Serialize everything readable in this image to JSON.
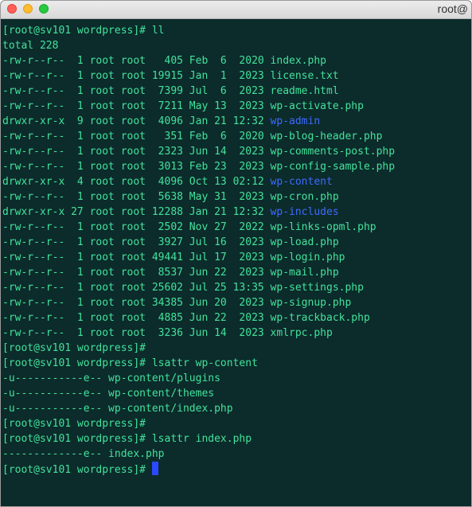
{
  "window": {
    "title": "root@"
  },
  "terminal": {
    "lines": [
      {
        "text": "[root@sv101 wordpress]# ll",
        "kind": "prompt"
      },
      {
        "text": "total 228",
        "kind": "text"
      },
      {
        "prefix": "-rw-r--r--  1 root root   405 Feb  6  2020 ",
        "name": "index.php",
        "kind": "file"
      },
      {
        "prefix": "-rw-r--r--  1 root root 19915 Jan  1  2023 ",
        "name": "license.txt",
        "kind": "file"
      },
      {
        "prefix": "-rw-r--r--  1 root root  7399 Jul  6  2023 ",
        "name": "readme.html",
        "kind": "file"
      },
      {
        "prefix": "-rw-r--r--  1 root root  7211 May 13  2023 ",
        "name": "wp-activate.php",
        "kind": "file"
      },
      {
        "prefix": "drwxr-xr-x  9 root root  4096 Jan 21 12:32 ",
        "name": "wp-admin",
        "kind": "dir"
      },
      {
        "prefix": "-rw-r--r--  1 root root   351 Feb  6  2020 ",
        "name": "wp-blog-header.php",
        "kind": "file"
      },
      {
        "prefix": "-rw-r--r--  1 root root  2323 Jun 14  2023 ",
        "name": "wp-comments-post.php",
        "kind": "file"
      },
      {
        "prefix": "-rw-r--r--  1 root root  3013 Feb 23  2023 ",
        "name": "wp-config-sample.php",
        "kind": "file"
      },
      {
        "prefix": "drwxr-xr-x  4 root root  4096 Oct 13 02:12 ",
        "name": "wp-content",
        "kind": "dir"
      },
      {
        "prefix": "-rw-r--r--  1 root root  5638 May 31  2023 ",
        "name": "wp-cron.php",
        "kind": "file"
      },
      {
        "prefix": "drwxr-xr-x 27 root root 12288 Jan 21 12:32 ",
        "name": "wp-includes",
        "kind": "dir"
      },
      {
        "prefix": "-rw-r--r--  1 root root  2502 Nov 27  2022 ",
        "name": "wp-links-opml.php",
        "kind": "file"
      },
      {
        "prefix": "-rw-r--r--  1 root root  3927 Jul 16  2023 ",
        "name": "wp-load.php",
        "kind": "file"
      },
      {
        "prefix": "-rw-r--r--  1 root root 49441 Jul 17  2023 ",
        "name": "wp-login.php",
        "kind": "file"
      },
      {
        "prefix": "-rw-r--r--  1 root root  8537 Jun 22  2023 ",
        "name": "wp-mail.php",
        "kind": "file"
      },
      {
        "prefix": "-rw-r--r--  1 root root 25602 Jul 25 13:35 ",
        "name": "wp-settings.php",
        "kind": "file"
      },
      {
        "prefix": "-rw-r--r--  1 root root 34385 Jun 20  2023 ",
        "name": "wp-signup.php",
        "kind": "file"
      },
      {
        "prefix": "-rw-r--r--  1 root root  4885 Jun 22  2023 ",
        "name": "wp-trackback.php",
        "kind": "file"
      },
      {
        "prefix": "-rw-r--r--  1 root root  3236 Jun 14  2023 ",
        "name": "xmlrpc.php",
        "kind": "file"
      },
      {
        "text": "[root@sv101 wordpress]#",
        "kind": "prompt"
      },
      {
        "text": "[root@sv101 wordpress]# lsattr wp-content",
        "kind": "prompt"
      },
      {
        "text": "-u-----------e-- wp-content/plugins",
        "kind": "text"
      },
      {
        "text": "-u-----------e-- wp-content/themes",
        "kind": "text"
      },
      {
        "text": "-u-----------e-- wp-content/index.php",
        "kind": "text"
      },
      {
        "text": "[root@sv101 wordpress]#",
        "kind": "prompt"
      },
      {
        "text": "[root@sv101 wordpress]# lsattr index.php",
        "kind": "prompt"
      },
      {
        "text": "-------------e-- index.php",
        "kind": "text"
      },
      {
        "text": "[root@sv101 wordpress]# ",
        "kind": "cursor-prompt"
      }
    ]
  },
  "colors": {
    "background": "#0c2b2b",
    "foreground": "#42e39b",
    "directory": "#3d6bff",
    "cursor": "#2b49ff"
  }
}
